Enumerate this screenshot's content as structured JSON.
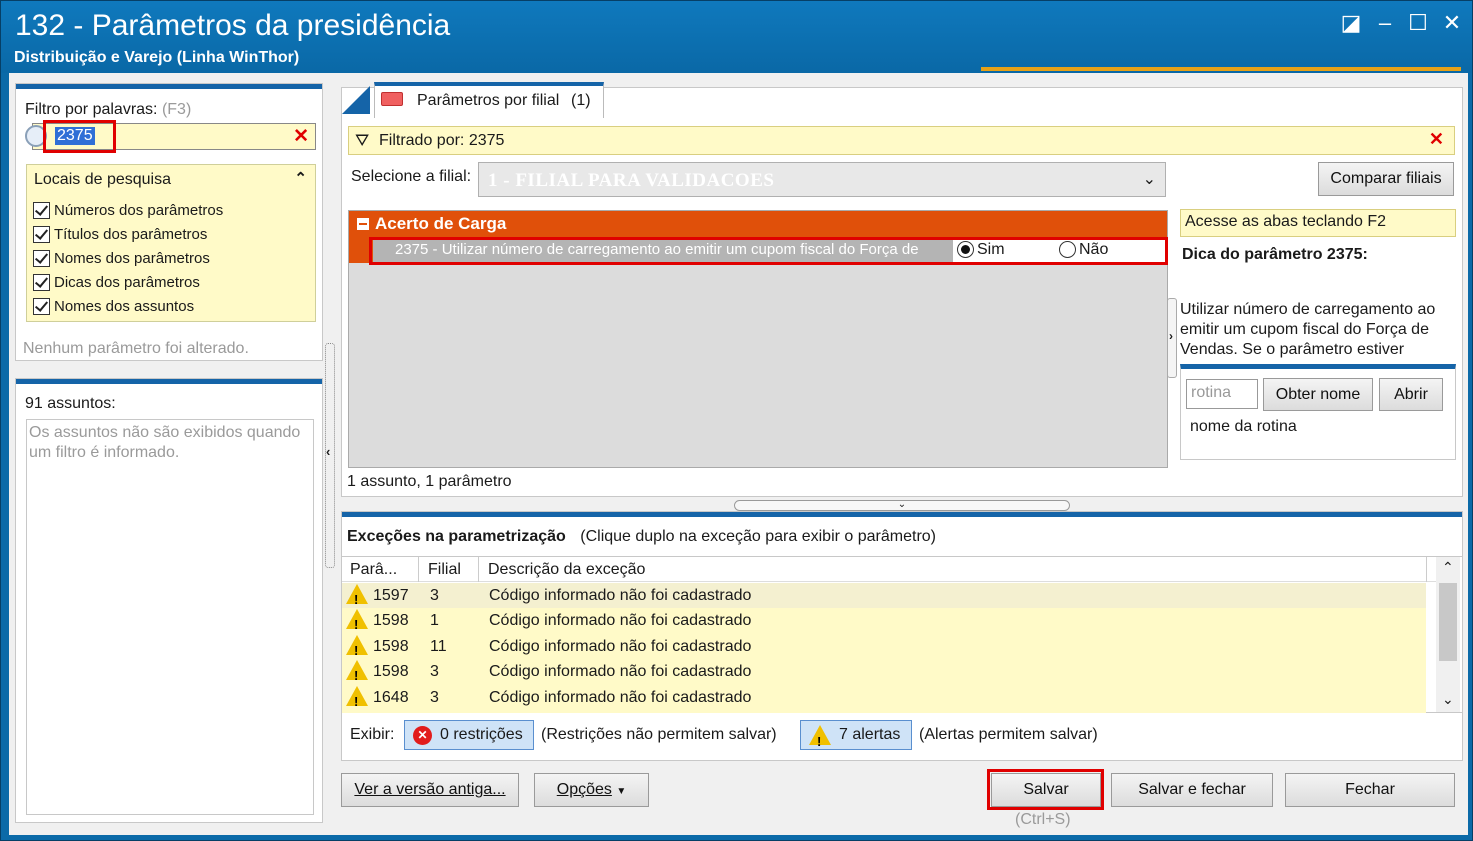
{
  "window": {
    "title": "132 - Parâmetros da presidência",
    "subtitle": "Distribuição e Varejo (Linha WinThor)",
    "controls": [
      "◪",
      "–",
      "☐",
      "✕"
    ]
  },
  "filter": {
    "label": "Filtro por palavras:",
    "shortcut": "(F3)",
    "value": "2375",
    "clear_icon": "✕"
  },
  "search_locations": {
    "title": "Locais de pesquisa",
    "options": [
      {
        "label": "Números dos parâmetros",
        "checked": true
      },
      {
        "label": "Títulos dos parâmetros",
        "checked": true
      },
      {
        "label": "Nomes dos parâmetros",
        "checked": true
      },
      {
        "label": "Dicas dos parâmetros",
        "checked": true
      },
      {
        "label": "Nomes dos assuntos",
        "checked": true
      }
    ],
    "status": "Nenhum parâmetro foi alterado."
  },
  "subjects": {
    "title": "91 assuntos:",
    "message": "Os assuntos não são exibidos quando um filtro é informado."
  },
  "tabs": [
    {
      "label": "Parâmetros por filial",
      "count": "(1)"
    }
  ],
  "filtered_by": "Filtrado por: 2375",
  "branch": {
    "label": "Selecione a filial:",
    "value": "1 - FILIAL PARA VALIDACOES",
    "compare_button": "Comparar filiais"
  },
  "group": {
    "title": "Acerto de Carga",
    "param_text": "2375 - Utilizar número de carregamento ao emitir um cupom fiscal do Força de",
    "option_yes": "Sim",
    "option_no": "Não",
    "selected": "Sim"
  },
  "summary": "1 assunto, 1 parâmetro",
  "hint": {
    "tab_tip": "Acesse as abas teclando F2",
    "title": "Dica do parâmetro 2375:",
    "text": "Utilizar número de carregamento ao emitir um cupom fiscal do Força de Vendas. Se o parâmetro estiver"
  },
  "routine": {
    "placeholder": "rotina",
    "get_name_button": "Obter nome",
    "open_button": "Abrir",
    "name_label": "nome da rotina"
  },
  "exceptions": {
    "title": "Exceções na parametrização",
    "note": "(Clique duplo na exceção para exibir o parâmetro)",
    "columns": [
      "Parâ...",
      "Filial",
      "Descrição da exceção"
    ],
    "rows": [
      {
        "param": "1597",
        "branch": "3",
        "description": "Código informado não foi cadastrado"
      },
      {
        "param": "1598",
        "branch": "1",
        "description": "Código informado não foi cadastrado"
      },
      {
        "param": "1598",
        "branch": "11",
        "description": "Código informado não foi cadastrado"
      },
      {
        "param": "1598",
        "branch": "3",
        "description": "Código informado não foi cadastrado"
      },
      {
        "param": "1648",
        "branch": "3",
        "description": "Código informado não foi cadastrado"
      }
    ],
    "show_label": "Exibir:",
    "restrictions_button": "0 restrições",
    "restrictions_note": "(Restrições não permitem salvar)",
    "alerts_button": "7 alertas",
    "alerts_note": "(Alertas permitem salvar)"
  },
  "footer": {
    "old_version_button": "Ver a versão antiga...",
    "options_button": "Opções",
    "save_button": "Salvar",
    "save_shortcut": "(Ctrl+S)",
    "save_close_button": "Salvar e fechar",
    "close_button": "Fechar"
  }
}
